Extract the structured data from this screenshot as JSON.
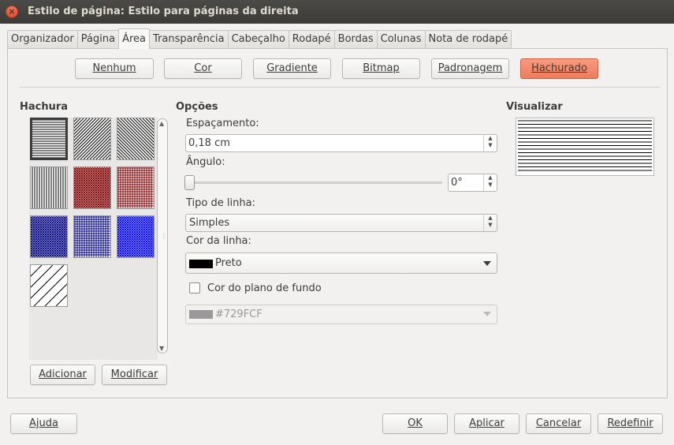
{
  "window": {
    "title": "Estilo de página: Estilo para páginas da direita",
    "close_icon": "close-icon"
  },
  "tabs": [
    {
      "label": "Organizador",
      "active": false
    },
    {
      "label": "Página",
      "active": false
    },
    {
      "label": "Área",
      "active": true
    },
    {
      "label": "Transparência",
      "active": false
    },
    {
      "label": "Cabeçalho",
      "active": false
    },
    {
      "label": "Rodapé",
      "active": false
    },
    {
      "label": "Bordas",
      "active": false
    },
    {
      "label": "Colunas",
      "active": false
    },
    {
      "label": "Nota de rodapé",
      "active": false
    }
  ],
  "fill_buttons": {
    "none": "Nenhum",
    "color": "Cor",
    "gradient": "Gradiente",
    "bitmap": "Bitmap",
    "pattern": "Padronagem",
    "hatch": "Hachurado",
    "active": "hatch"
  },
  "hatch_list": {
    "heading": "Hachura",
    "add": "Adicionar",
    "modify": "Modificar",
    "items": [
      {
        "name": "black-horizontal",
        "color": "#000000",
        "selected": true
      },
      {
        "name": "black-diagonal-45",
        "color": "#000000"
      },
      {
        "name": "black-diagonal-neg45",
        "color": "#000000"
      },
      {
        "name": "black-vertical",
        "color": "#000000"
      },
      {
        "name": "red-crosshatch-diagonal",
        "color": "#800000"
      },
      {
        "name": "red-crosshatch",
        "color": "#800000"
      },
      {
        "name": "blue-crosshatch-diagonal",
        "color": "#000080"
      },
      {
        "name": "blue-crosshatch",
        "color": "#000080"
      },
      {
        "name": "bright-blue-crosshatch",
        "color": "#0000ff"
      },
      {
        "name": "black-wide-diagonal",
        "color": "#000000"
      }
    ]
  },
  "options": {
    "heading": "Opções",
    "spacing_label": "Espaçamento:",
    "spacing_value": "0,18 cm",
    "angle_label": "Ângulo:",
    "angle_value": "0°",
    "angle_slider_fraction": 0,
    "line_type_label": "Tipo de linha:",
    "line_type_value": "Simples",
    "line_color_label": "Cor da linha:",
    "line_color_value": "Preto",
    "line_color_swatch": "#000000",
    "background_color_label": "Cor do plano de fundo",
    "background_color_checked": false,
    "background_color_value": "#729FCF",
    "background_color_swatch": "#999999"
  },
  "preview": {
    "heading": "Visualizar"
  },
  "footer": {
    "help": "Ajuda",
    "ok": "OK",
    "apply": "Aplicar",
    "cancel": "Cancelar",
    "reset": "Redefinir"
  }
}
